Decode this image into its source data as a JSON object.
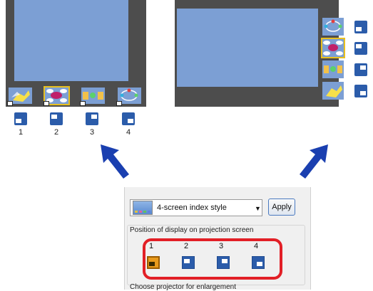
{
  "left_preview": {
    "position_numbers": [
      "1",
      "2",
      "3",
      "4"
    ]
  },
  "dialog": {
    "style_select_value": "4-screen index style",
    "apply_label": "Apply",
    "position_group_label": "Position of display on projection screen",
    "position_options": [
      "1",
      "2",
      "3",
      "4"
    ],
    "selected_position": "1",
    "next_group_label": "Choose projector for enlargement"
  },
  "colors": {
    "screen_bg": "#4d4d4d",
    "image_fill": "#7c9fd4",
    "position_icon": "#2b5caa",
    "selected_icon": "#e89a1c",
    "highlight_border": "#e21f26",
    "arrow": "#1a3fb0"
  }
}
